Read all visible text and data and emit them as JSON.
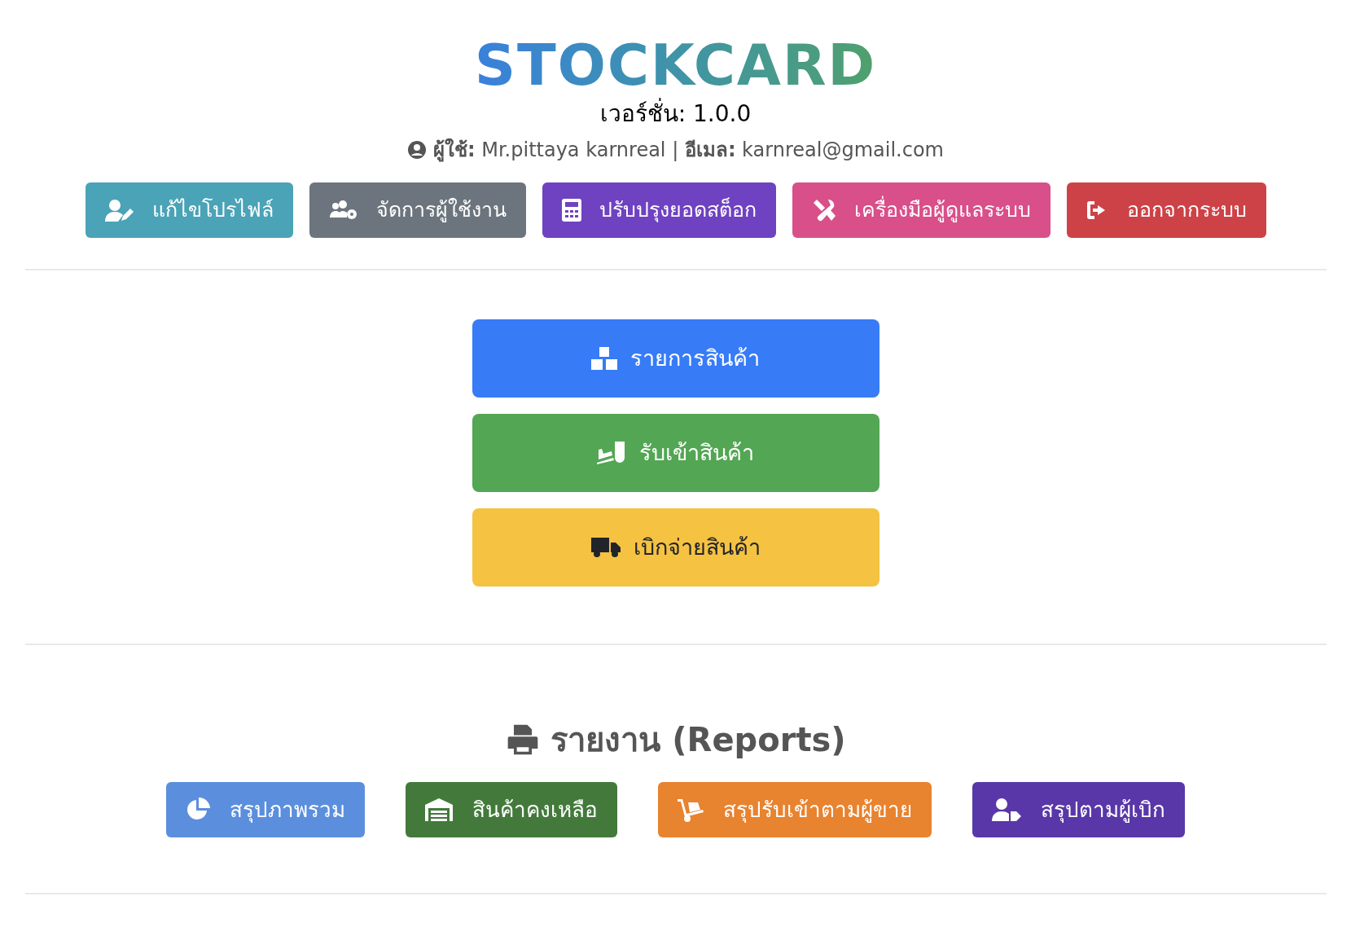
{
  "header": {
    "title": "STOCKCARD",
    "version": "เวอร์ชั่น: 1.0.0",
    "user_line": "**ผู้ใช้:** Mr.pittaya karnreal | **อีเมล:** karnreal@gmail.com"
  },
  "toolbar": [
    {
      "label": "แก้ไขโปรไฟล์",
      "color": "#4aa3b6"
    },
    {
      "label": "จัดการผู้ใช้งาน",
      "color": "#6c757d"
    },
    {
      "label": "ปรับปรุงยอดสต็อก",
      "color": "#6f42c1"
    },
    {
      "label": "เครื่องมือผู้ดูแลระบบ",
      "color": "#d94f8a"
    },
    {
      "label": "ออกจากระบบ",
      "color": "#cd4247"
    }
  ],
  "main_actions": [
    {
      "label": "รายการสินค้า",
      "color": "#377cf6"
    },
    {
      "label": "รับเข้าสินค้า",
      "color": "#53a653"
    },
    {
      "label": "เบิกจ่ายสินค้า",
      "color": "#f5c242"
    }
  ],
  "reports": {
    "heading": "รายงาน (Reports)",
    "buttons": [
      {
        "label": "สรุปภาพรวม",
        "color": "#5b8fdd"
      },
      {
        "label": "สินค้าคงเหลือ",
        "color": "#437a3b"
      },
      {
        "label": "สรุปรับเข้าตามผู้ขาย",
        "color": "#e8832f"
      },
      {
        "label": "สรุปตามผู้เบิก",
        "color": "#5937a8"
      }
    ]
  }
}
